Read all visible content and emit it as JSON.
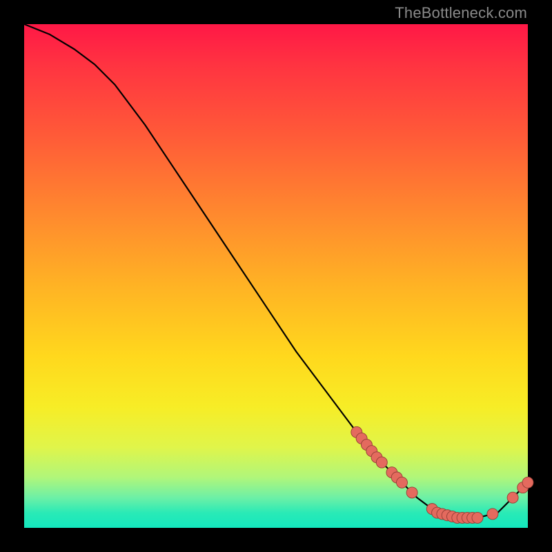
{
  "watermark": "TheBottleneck.com",
  "chart_data": {
    "type": "line",
    "title": "",
    "xlabel": "",
    "ylabel": "",
    "xlim": [
      0,
      100
    ],
    "ylim": [
      0,
      100
    ],
    "grid": false,
    "legend": false,
    "curve": {
      "x": [
        0,
        5,
        10,
        14,
        18,
        24,
        30,
        36,
        42,
        48,
        54,
        60,
        66,
        70,
        74,
        78,
        82,
        86,
        90,
        94,
        97,
        100
      ],
      "y": [
        100,
        98,
        95,
        92,
        88,
        80,
        71,
        62,
        53,
        44,
        35,
        27,
        19,
        14,
        10,
        6,
        3,
        2,
        2,
        3,
        6,
        9
      ]
    },
    "markers_along_curve_x": [
      66,
      67,
      68,
      69,
      70,
      71,
      73,
      74,
      75,
      77,
      81,
      82,
      83,
      84,
      85,
      86,
      87,
      88,
      89,
      90,
      93,
      97,
      99,
      100
    ],
    "marker_radius": 8,
    "colors": {
      "curve": "#000000",
      "marker_fill": "#e46a5e",
      "marker_stroke": "#923d34",
      "gradient_top": "#ff1846",
      "gradient_bottom": "#13e7be"
    }
  }
}
